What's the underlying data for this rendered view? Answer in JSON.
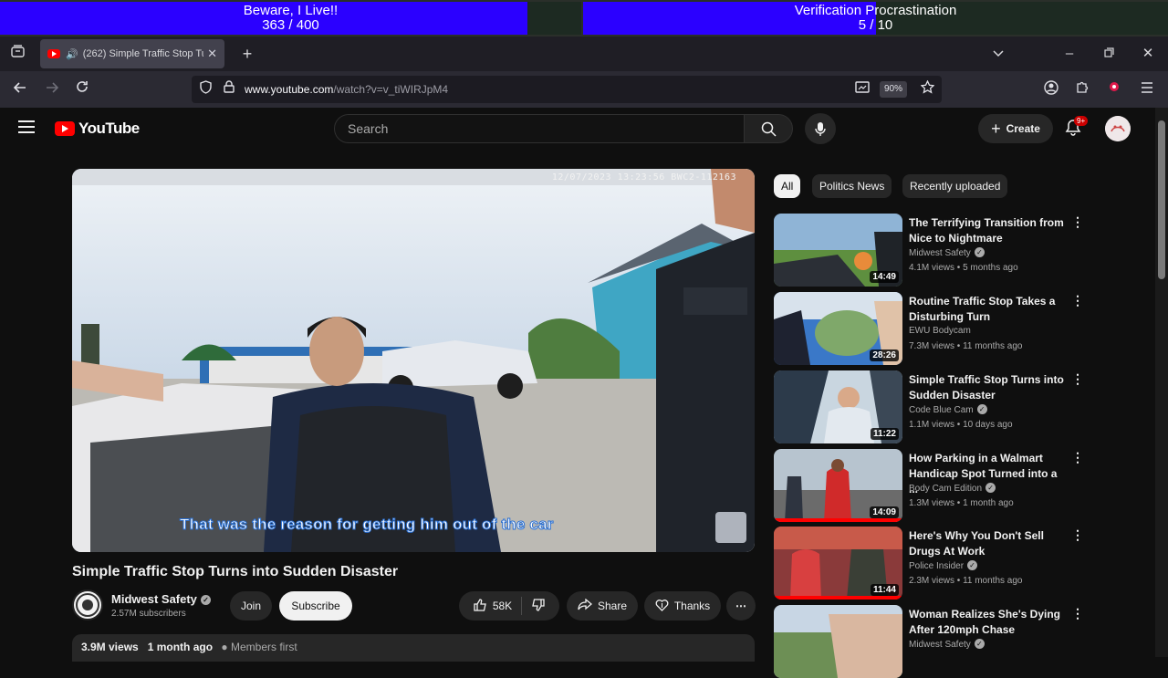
{
  "overlay": {
    "bar1": {
      "title": "Beware, I Live!!",
      "value": "363 / 400",
      "progress": 0.9075
    },
    "bar2": {
      "title": "Verification Procrastination",
      "value": "5 / 10",
      "progress": 0.5
    }
  },
  "browser": {
    "tab_title": "(262) Simple Traffic Stop Tu",
    "url_host": "www.youtube.com",
    "url_path": "/watch?v=v_tiWIRJpM4",
    "zoom": "90%"
  },
  "youtube": {
    "logo_text": "YouTube",
    "search_placeholder": "Search",
    "create_label": "Create",
    "notifications_badge": "9+",
    "video": {
      "timestamp": "12/07/2023 13:23:56 BWC2-112163",
      "caption": "That was the reason for getting him out of the car",
      "title": "Simple Traffic Stop Turns into Sudden Disaster",
      "channel": "Midwest Safety",
      "subscribers": "2.57M subscribers",
      "join_label": "Join",
      "subscribe_label": "Subscribe",
      "likes": "58K",
      "share_label": "Share",
      "thanks_label": "Thanks",
      "views": "3.9M views",
      "age": "1 month ago",
      "members": "Members first"
    },
    "chips": [
      "All",
      "Politics News",
      "Recently uploaded"
    ],
    "recommendations": [
      {
        "title": "The Terrifying Transition from Nice to Nightmare",
        "channel": "Midwest Safety",
        "verified": true,
        "meta": "4.1M views • 5 months ago",
        "duration": "14:49"
      },
      {
        "title": "Routine Traffic Stop Takes a Disturbing Turn",
        "channel": "EWU Bodycam",
        "verified": false,
        "meta": "7.3M views • 11 months ago",
        "duration": "28:26"
      },
      {
        "title": "Simple Traffic Stop Turns into Sudden Disaster",
        "channel": "Code Blue Cam",
        "verified": true,
        "meta": "1.1M views • 10 days ago",
        "duration": "11:22"
      },
      {
        "title": "How Parking in a Walmart Handicap Spot Turned into a ...",
        "channel": "Body Cam Edition",
        "verified": true,
        "meta": "1.3M views • 1 month ago",
        "duration": "14:09"
      },
      {
        "title": "Here's Why You Don't Sell Drugs At Work",
        "channel": "Police Insider",
        "verified": true,
        "meta": "2.3M views • 11 months ago",
        "duration": "11:44"
      },
      {
        "title": "Woman Realizes She's Dying After 120mph Chase",
        "channel": "Midwest Safety",
        "verified": true,
        "meta": "",
        "duration": ""
      }
    ]
  },
  "colors": {
    "overlay_fill": "#2b00ff",
    "youtube_red": "#ff0000"
  }
}
